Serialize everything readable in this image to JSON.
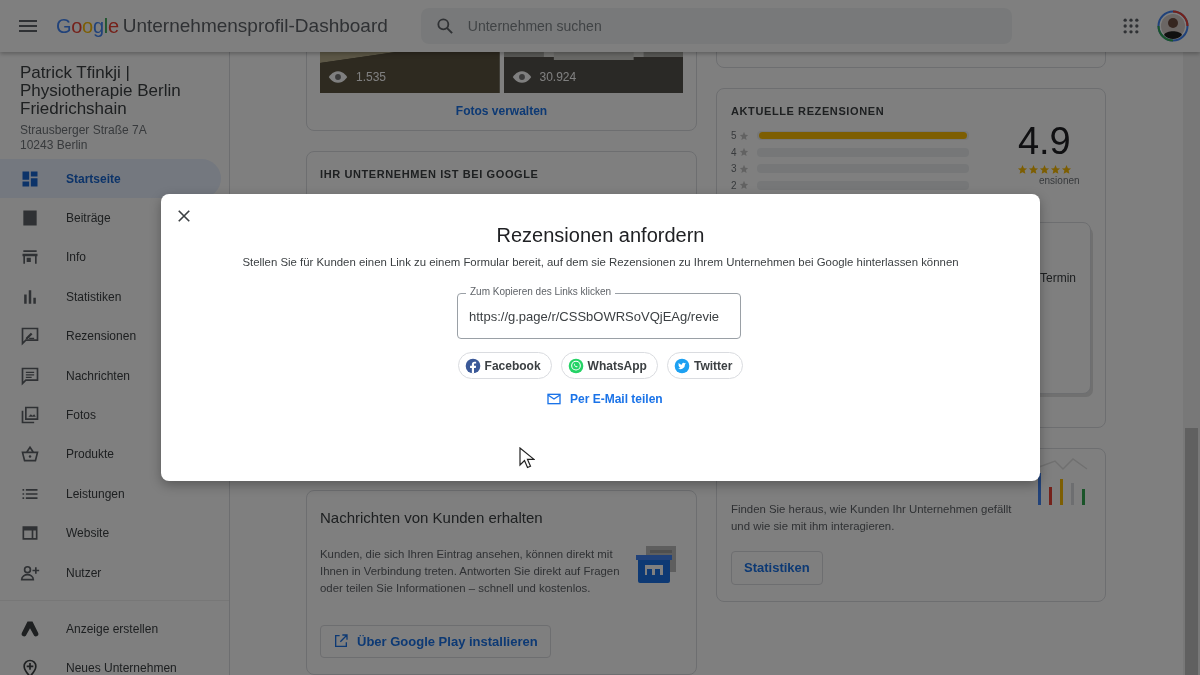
{
  "header": {
    "logo": "Google",
    "title": "Unternehmensprofil-Dashboard",
    "search": {
      "placeholder": "Unternehmen suchen"
    }
  },
  "business": {
    "name": "Patrick Tfinkji | Physiotherapie Berlin Friedrichshain",
    "address": [
      "Strausberger Straße 7A",
      "10243 Berlin"
    ]
  },
  "sidebar": {
    "items": [
      {
        "label": "Startseite",
        "selected": true
      },
      {
        "label": "Beiträge",
        "selected": false
      },
      {
        "label": "Info",
        "selected": false
      },
      {
        "label": "Statistiken",
        "selected": false
      },
      {
        "label": "Rezensionen",
        "selected": false
      },
      {
        "label": "Nachrichten",
        "selected": false
      },
      {
        "label": "Fotos",
        "selected": false
      },
      {
        "label": "Produkte",
        "selected": false
      },
      {
        "label": "Leistungen",
        "selected": false
      },
      {
        "label": "Website",
        "selected": false
      },
      {
        "label": "Nutzer",
        "selected": false
      }
    ],
    "extra_items": [
      {
        "label": "Anzeige erstellen"
      },
      {
        "label": "Neues Unternehmen"
      }
    ]
  },
  "photos_card": {
    "photos": [
      {
        "views": "1.535"
      },
      {
        "views": "30.924"
      }
    ],
    "link": "Fotos verwalten"
  },
  "presence_card": {
    "title": "IHR UNTERNEHMEN IST BEI GOOGLE"
  },
  "messages_card": {
    "title": "Nachrichten von Kunden erhalten",
    "text": "Kunden, die sich Ihren Eintrag ansehen, können direkt mit Ihnen in Verbindung treten. Antworten Sie direkt auf Fragen oder teilen Sie Informationen – schnell und kostenlos.",
    "button": "Über Google Play installieren"
  },
  "reviews_card": {
    "title": "AKTUELLE REZENSIONEN",
    "bars": [
      {
        "label": "5",
        "level": 1
      },
      {
        "label": "4",
        "level": 0
      },
      {
        "label": "3",
        "level": 0
      },
      {
        "label": "2",
        "level": 0
      }
    ],
    "rating": "4.9",
    "stars": 5,
    "count": "ensionen",
    "booking_text": "Termin"
  },
  "stats_card": {
    "text": "Finden Sie heraus, wie Kunden Ihr Unternehmen gefällt und wie sie mit ihm interagieren.",
    "button": "Statistiken"
  },
  "dialog": {
    "title": "Rezensionen anfordern",
    "description": "Stellen Sie für Kunden einen Link zu einem Formular bereit, auf dem sie Rezensionen zu Ihrem Unternehmen bei Google hinterlassen können",
    "link_field": {
      "label": "Zum Kopieren des Links klicken",
      "value": "https://g.page/r/CSSbOWRSoVQjEAg/revie"
    },
    "share_buttons": [
      {
        "label": "Facebook",
        "kind": "facebook"
      },
      {
        "label": "WhatsApp",
        "kind": "whatsapp"
      },
      {
        "label": "Twitter",
        "kind": "twitter"
      }
    ],
    "email_link": "Per E-Mail teilen"
  }
}
